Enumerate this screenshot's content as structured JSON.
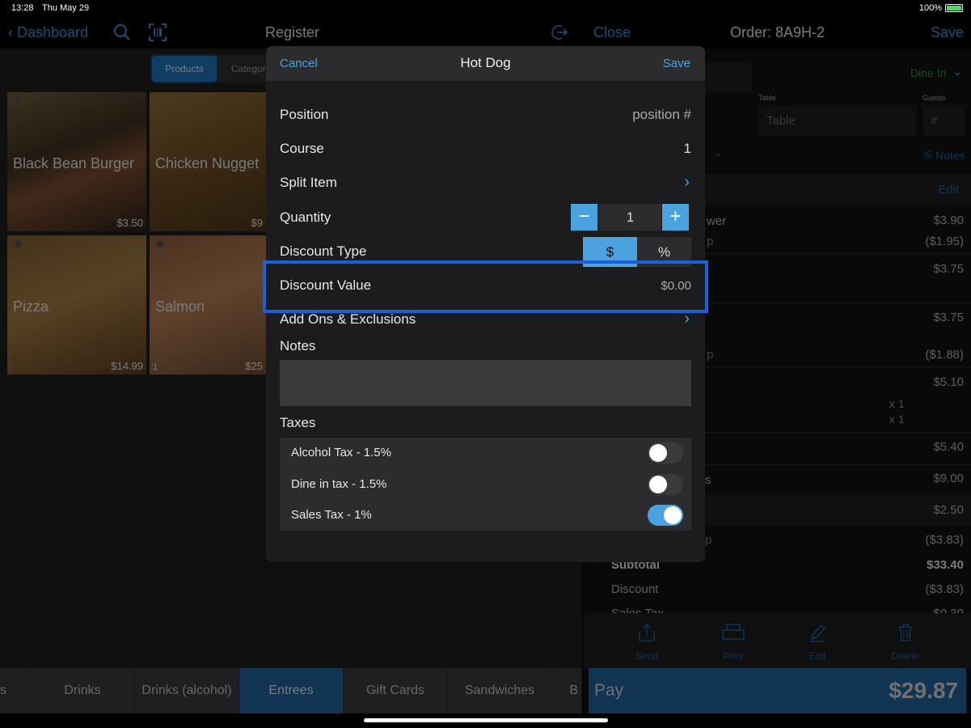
{
  "status": {
    "time": "13:28",
    "date": "Thu May 29",
    "battery": "100%"
  },
  "register": {
    "back_label": "Dashboard",
    "title": "Register",
    "segments": [
      "Products",
      "Categor"
    ],
    "products": [
      {
        "name": "Black Bean Burger",
        "price": "$3.50"
      },
      {
        "name": "Chicken Nugget",
        "price": "$9"
      },
      {
        "name": "Pizza",
        "price": "$14.99"
      },
      {
        "name": "Salmon",
        "price": "$25",
        "count": "1"
      }
    ],
    "categories": [
      "s",
      "Drinks",
      "Drinks (alcohol)",
      "Entrees",
      "Gift Cards",
      "Sandwiches",
      "B"
    ],
    "active_category": "Entrees"
  },
  "order": {
    "close_label": "Close",
    "title": "Order: 8A9H-2",
    "save_label": "Save",
    "dine_in": "Dine In",
    "table_label": "Table",
    "table_placeholder": "Table",
    "guests_label": "Guests",
    "guests_placeholder": "#",
    "notes_label": "Notes",
    "edit_label": "Edit",
    "items": [
      {
        "name": "wer",
        "price": "$3.90"
      },
      {
        "name": "p",
        "price": "($1.95)"
      },
      {
        "name": "",
        "price": "$3.75"
      },
      {
        "name": "",
        "price": "$3.75"
      },
      {
        "name": "p",
        "price": "($1.88)"
      },
      {
        "name": "",
        "price": "$5.10"
      },
      {
        "name": "x 1",
        "price": ""
      },
      {
        "name": "x 1",
        "price": ""
      },
      {
        "name": "",
        "price": "$5.40"
      },
      {
        "name": "s",
        "price": "$9.00"
      },
      {
        "name": "",
        "price": "$2.50"
      },
      {
        "name": "p",
        "price": "($3.83)"
      }
    ],
    "subtotal_label": "Subtotal",
    "subtotal": "$33.40",
    "discount_label": "Discount",
    "discount": "($3.83)",
    "sales_tax_label": "Sales Tax",
    "sales_tax": "$0.30",
    "tools": [
      "Send",
      "Print",
      "Edit",
      "Delete"
    ],
    "pay_label": "Pay",
    "pay_total": "$29.87"
  },
  "modal": {
    "cancel_label": "Cancel",
    "title": "Hot Dog",
    "save_label": "Save",
    "position_label": "Position",
    "position_placeholder": "position #",
    "course_label": "Course",
    "course_value": "1",
    "split_label": "Split Item",
    "quantity_label": "Quantity",
    "quantity_value": "1",
    "discount_type_label": "Discount Type",
    "discount_type_options": [
      "$",
      "%"
    ],
    "discount_type_selected": "$",
    "discount_value_label": "Discount Value",
    "discount_value": "$0.00",
    "addons_label": "Add Ons & Exclusions",
    "notes_label": "Notes",
    "taxes_label": "Taxes",
    "taxes": [
      {
        "name": "Alcohol Tax - 1.5%",
        "enabled": false
      },
      {
        "name": "Dine in tax - 1.5%",
        "enabled": false
      },
      {
        "name": "Sales Tax - 1%",
        "enabled": true
      }
    ]
  },
  "colors": {
    "accent": "#4aa3df",
    "highlight": "#1c5fd8",
    "pay": "#1f5f98"
  }
}
